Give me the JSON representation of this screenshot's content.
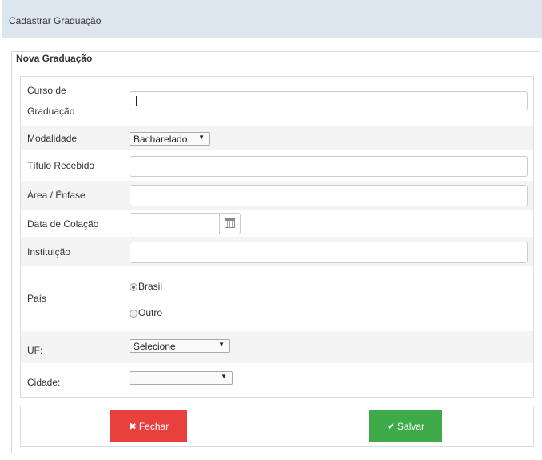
{
  "window": {
    "title": "Cadastrar Graduação"
  },
  "section": {
    "legend": "Nova Graduação"
  },
  "fields": {
    "curso": {
      "label_line1": "Curso de",
      "label_line2": "Graduação",
      "value": ""
    },
    "modalidade": {
      "label": "Modalidade",
      "selected": "Bacharelado"
    },
    "titulo": {
      "label": "Título Recebido",
      "value": ""
    },
    "area": {
      "label": "Área / Ênfase",
      "value": ""
    },
    "data_colacao": {
      "label": "Data de Colação",
      "value": ""
    },
    "instituicao": {
      "label": "Instituição",
      "value": ""
    },
    "pais": {
      "label": "País",
      "options": [
        "Brasil",
        "Outro"
      ],
      "selected": "Brasil"
    },
    "uf": {
      "label": "UF:",
      "selected": "Selecione"
    },
    "cidade": {
      "label": "Cidade:",
      "selected": ""
    }
  },
  "buttons": {
    "close_label": "Fechar",
    "save_label": "Salvar"
  },
  "colors": {
    "close": "#e8403d",
    "save": "#3eaa4a",
    "titlebar": "#dde5ee"
  },
  "icons": {
    "close": "x-icon",
    "save": "check-icon",
    "date": "calendar-icon"
  }
}
